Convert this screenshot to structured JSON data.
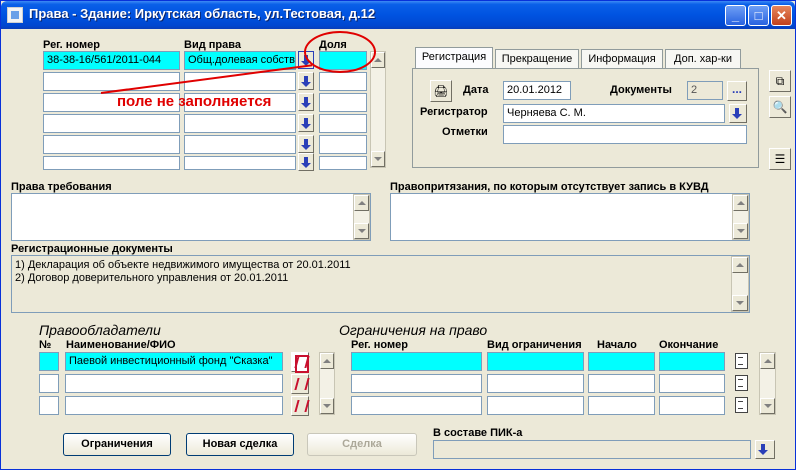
{
  "window": {
    "title": "Права - Здание: Иркутская область, ул.Тестовая, д.12",
    "min": "_",
    "max": "□",
    "close": "✕"
  },
  "rights": {
    "headers": {
      "reg_num": "Рег. номер",
      "type": "Вид права",
      "share": "Доля"
    },
    "rows": [
      {
        "reg_num": "38-38-16/561/2011-044",
        "type": "Общ.долевая собств.",
        "share": ""
      },
      {
        "reg_num": "",
        "type": "",
        "share": ""
      },
      {
        "reg_num": "",
        "type": "",
        "share": ""
      },
      {
        "reg_num": "",
        "type": "",
        "share": ""
      },
      {
        "reg_num": "",
        "type": "",
        "share": ""
      },
      {
        "reg_num": "",
        "type": "",
        "share": ""
      }
    ]
  },
  "annotation": {
    "text": "поле не заполняется"
  },
  "tabs": [
    "Регистрация",
    "Прекращение",
    "Информация",
    "Доп. хар-ки"
  ],
  "registration": {
    "date_label": "Дата",
    "date_value": "20.01.2012",
    "docs_label": "Документы",
    "docs_value": "2",
    "docs_btn": "...",
    "registrar_label": "Регистратор",
    "registrar_value": "Черняева С. М.",
    "notes_label": "Отметки",
    "notes_value": ""
  },
  "claims": {
    "label": "Права требования"
  },
  "pretensions": {
    "label": "Правопритязания, по которым отсутствует запись в КУВД"
  },
  "reg_docs": {
    "label": "Регистрационные документы",
    "items": [
      "1) Декларация об объекте недвижимого имущества от 20.01.2011",
      "2) Договор доверительного управления от 20.01.2011"
    ]
  },
  "owners": {
    "title": "Правообладатели",
    "col_num": "№",
    "col_name": "Наименование/ФИО",
    "rows": [
      {
        "num": "",
        "name": "Паевой инвестиционный фонд \"Сказка\""
      },
      {
        "num": "",
        "name": ""
      },
      {
        "num": "",
        "name": ""
      }
    ]
  },
  "restrictions": {
    "title": "Ограничения на право",
    "cols": {
      "reg": "Рег. номер",
      "type": "Вид ограничения",
      "start": "Начало",
      "end": "Окончание"
    }
  },
  "buttons": {
    "restrictions": "Ограничения",
    "new_deal": "Новая сделка",
    "deal": "Сделка"
  },
  "pik": {
    "label": "В составе ПИК-а",
    "value": ""
  }
}
